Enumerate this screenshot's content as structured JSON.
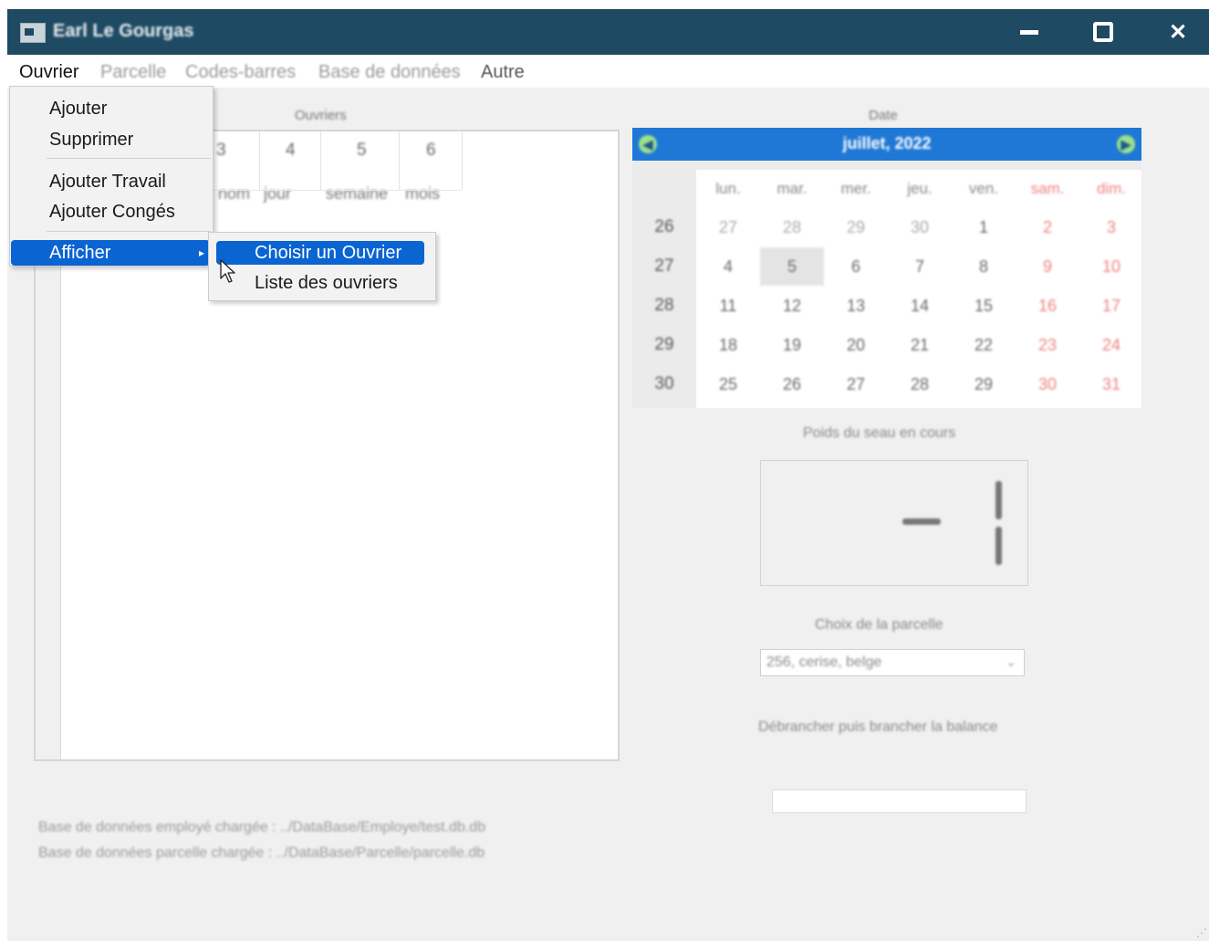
{
  "window": {
    "title": "Earl Le Gourgas",
    "controls": {
      "minimize": "minimize-icon",
      "maximize": "maximize-icon",
      "close": "✕"
    }
  },
  "menubar": {
    "items": [
      "Ouvrier",
      "Parcelle",
      "Codes-barres",
      "Base de données",
      "Autre"
    ]
  },
  "dropdown": {
    "items": [
      "Ajouter",
      "Supprimer",
      "Ajouter Travail",
      "Ajouter Congés",
      "Afficher"
    ],
    "submenu_arrow": "▸",
    "submenu": [
      "Choisir un Ouvrier",
      "Liste des ouvriers"
    ]
  },
  "workers_panel": {
    "label": "Ouvriers",
    "column_numbers": [
      "3",
      "4",
      "5",
      "6"
    ],
    "column_names": [
      "nom",
      "jour",
      "semaine",
      "mois"
    ]
  },
  "calendar": {
    "label": "Date",
    "month_title": "juillet, 2022",
    "nav_prev": "◀",
    "nav_next": "▶",
    "weekdays": [
      "lun.",
      "mar.",
      "mer.",
      "jeu.",
      "ven.",
      "sam.",
      "dim."
    ],
    "weeks": [
      "26",
      "27",
      "28",
      "29",
      "30"
    ],
    "days": [
      [
        "27",
        "28",
        "29",
        "30",
        "1",
        "2",
        "3"
      ],
      [
        "4",
        "5",
        "6",
        "7",
        "8",
        "9",
        "10"
      ],
      [
        "11",
        "12",
        "13",
        "14",
        "15",
        "16",
        "17"
      ],
      [
        "18",
        "19",
        "20",
        "21",
        "22",
        "23",
        "24"
      ],
      [
        "25",
        "26",
        "27",
        "28",
        "29",
        "30",
        "31"
      ]
    ],
    "selected_day": "5",
    "weekend_color": "#f08080",
    "header_color": "#1f78d6"
  },
  "weight": {
    "label": "Poids du seau en cours"
  },
  "parcelle": {
    "label": "Choix de la parcelle",
    "selected": "256, cerise, belge",
    "chevron": "⌄"
  },
  "scale": {
    "label": "Débrancher puis brancher la balance"
  },
  "status": {
    "employe": "Base de données employé chargée : ../DataBase/Employe/test.db.db",
    "parcelle": "Base de données parcelle chargée : ../DataBase/Parcelle/parcelle.db"
  },
  "colors": {
    "titlebar": "#1f4a63",
    "highlight": "#0a64d2"
  }
}
